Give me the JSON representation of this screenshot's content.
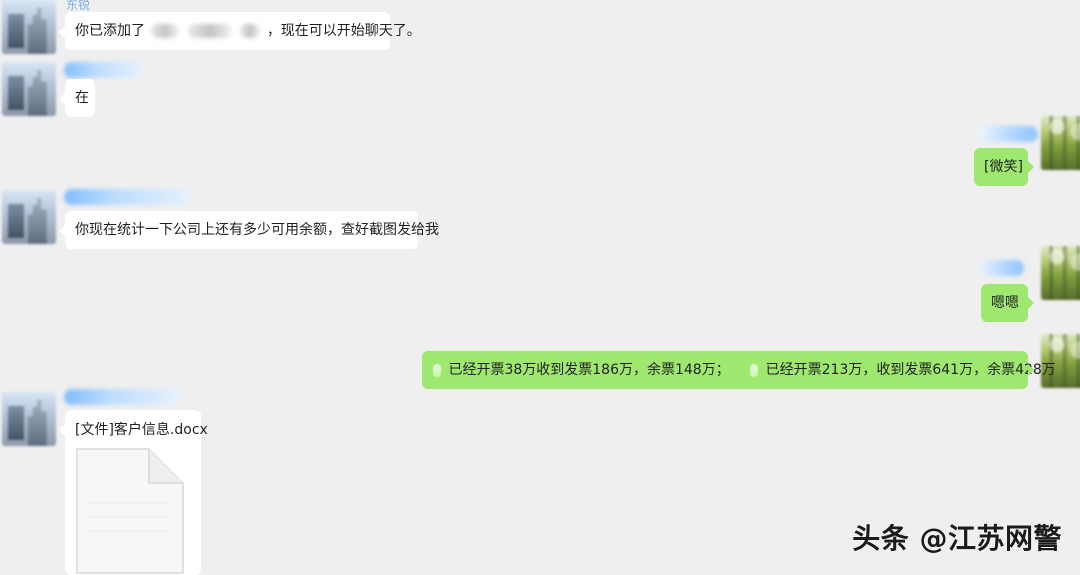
{
  "left_messages": [
    {
      "name_text": "东锐",
      "text_before": "你已添加了",
      "text_after": "，现在可以开始聊天了。"
    },
    {
      "text": "在"
    },
    {
      "text": "你现在统计一下公司上还有多少可用余额，查好截图发给我"
    },
    {
      "file_label": "[文件]客户信息.docx"
    }
  ],
  "right_messages": [
    {
      "text": "[微笑]"
    },
    {
      "text": "嗯嗯"
    },
    {
      "text_part1": "已经开票38万收到发票186万，余票148万；",
      "text_part2": "已经开票213万，收到发票641万，余票428万"
    }
  ],
  "watermark": "头条 @江苏网警",
  "colors": {
    "background": "#efefef",
    "incoming_bubble": "#ffffff",
    "outgoing_bubble": "#9fe870",
    "name_blur": "#a9d2ff"
  },
  "icons": {
    "file_icon": "document-icon"
  }
}
